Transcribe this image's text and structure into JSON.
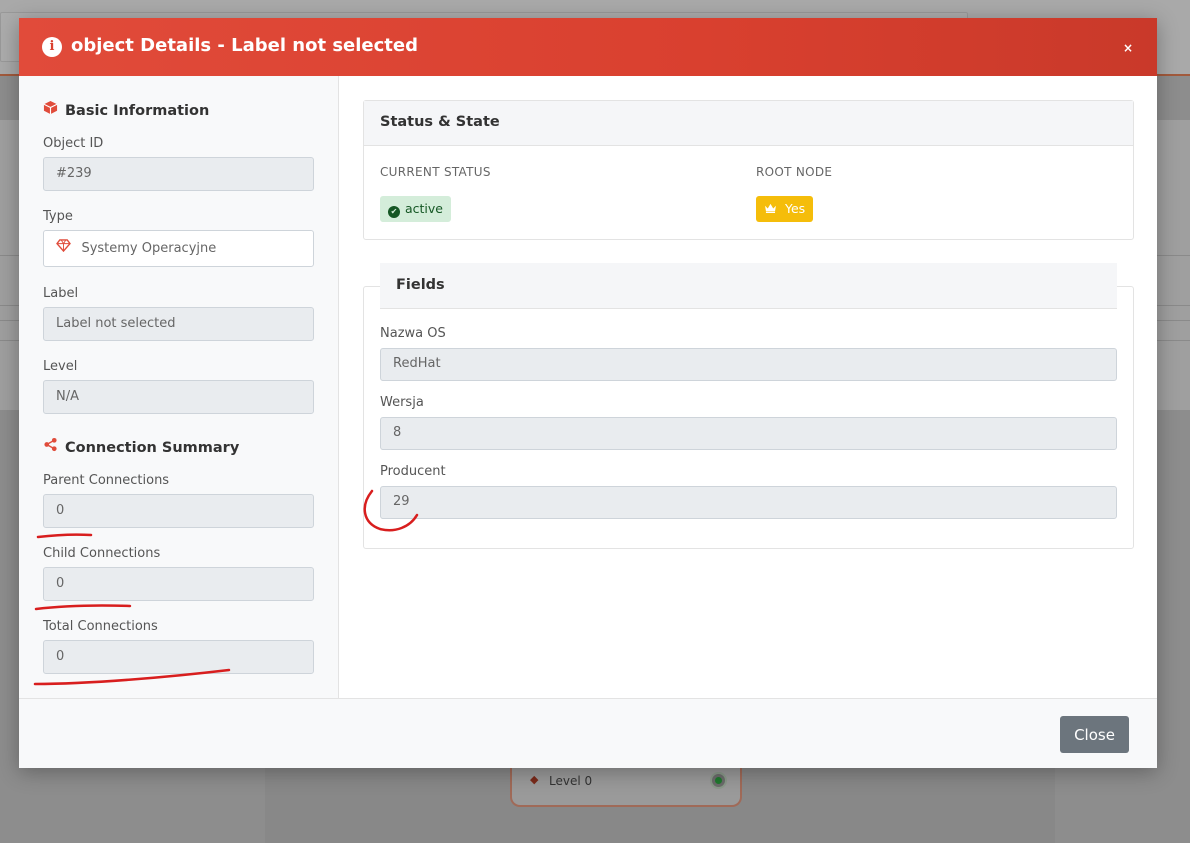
{
  "background": {
    "node_label": "Level 0"
  },
  "modal": {
    "title": "object Details - Label not selected",
    "close_icon": "×",
    "basic_info": {
      "title": "Basic Information",
      "object_id_label": "Object ID",
      "object_id": "#239",
      "type_label": "Type",
      "type": "Systemy Operacyjne",
      "label_label": "Label",
      "label": "Label not selected",
      "level_label": "Level",
      "level": "N/A"
    },
    "connection_summary": {
      "title": "Connection Summary",
      "parent_label": "Parent Connections",
      "parent": "0",
      "child_label": "Child Connections",
      "child": "0",
      "total_label": "Total Connections",
      "total": "0"
    },
    "status_state": {
      "title": "Status & State",
      "current_status_label": "CURRENT STATUS",
      "current_status": "active",
      "root_node_label": "ROOT NODE",
      "root_node": "Yes"
    },
    "fields": {
      "title": "Fields",
      "items": [
        {
          "label": "Nazwa OS",
          "value": "RedHat"
        },
        {
          "label": "Wersja",
          "value": "8"
        },
        {
          "label": "Producent",
          "value": "29"
        }
      ]
    },
    "footer": {
      "close_label": "Close"
    }
  },
  "colors": {
    "header_red": "#d9402f",
    "accent_red": "#e04c3b",
    "success_bg": "#d4edda",
    "warning": "#f5bd0a",
    "close_button": "#6c757d"
  },
  "icons": {
    "header": "info-icon",
    "basic_info": "cube-icon",
    "type": "gem-icon",
    "connection_summary": "share-nodes-icon",
    "status": "check-circle-icon",
    "root": "crown-icon"
  }
}
